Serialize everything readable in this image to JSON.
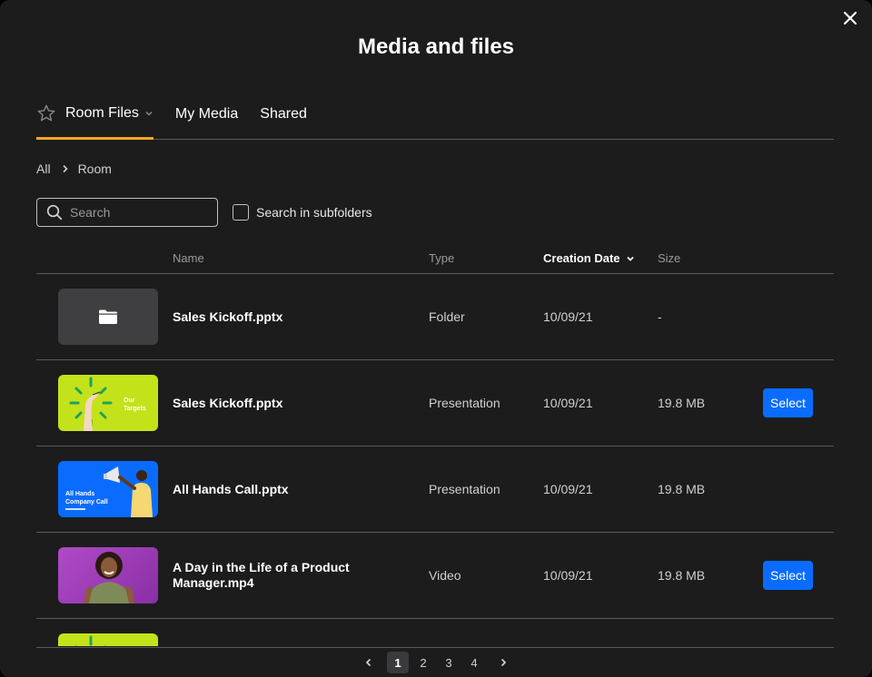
{
  "dialog": {
    "title": "Media and files"
  },
  "tabs": [
    {
      "label": "Room Files",
      "active": true
    },
    {
      "label": "My Media"
    },
    {
      "label": "Shared"
    }
  ],
  "breadcrumb": {
    "root": "All",
    "current": "Room"
  },
  "search": {
    "placeholder": "Search",
    "value": ""
  },
  "subfolders": {
    "label": "Search in subfolders",
    "checked": false
  },
  "table": {
    "columns": {
      "name": "Name",
      "type": "Type",
      "date": "Creation Date",
      "size": "Size"
    },
    "rows": [
      {
        "thumb": "folder",
        "name": "Sales Kickoff.pptx",
        "type": "Folder",
        "date": "10/09/21",
        "size": "-",
        "action": ""
      },
      {
        "thumb": "targets",
        "thumb_text": "Our Targets",
        "name": "Sales Kickoff.pptx",
        "type": "Presentation",
        "date": "10/09/21",
        "size": "19.8 MB",
        "action": "Select"
      },
      {
        "thumb": "allhands",
        "thumb_text": "All Hands Company Call",
        "name": "All Hands Call.pptx",
        "type": "Presentation",
        "date": "10/09/21",
        "size": "19.8 MB",
        "action": ""
      },
      {
        "thumb": "portrait",
        "name": "A Day in the Life of a Product Manager.mp4",
        "type": "Video",
        "date": "10/09/21",
        "size": "19.8 MB",
        "action": "Select"
      }
    ]
  },
  "pagination": {
    "pages": [
      "1",
      "2",
      "3",
      "4"
    ],
    "current": "1"
  },
  "colors": {
    "accent": "#f5a623",
    "primary_button": "#0a6cff",
    "background": "#1c1c1d",
    "lime": "#c4e21a",
    "blue": "#0a6cff",
    "purple": "#9b3fb8"
  },
  "icons": {
    "close": "close-icon",
    "star": "star-icon",
    "chevron": "chevron-down-icon",
    "search": "search-icon",
    "folder": "folder-icon"
  }
}
